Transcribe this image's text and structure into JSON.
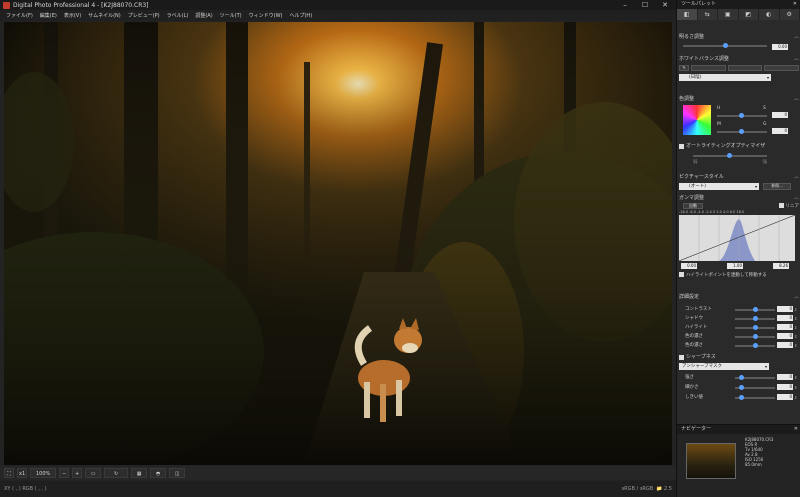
{
  "window": {
    "title": "Digital Photo Professional 4 - [K2J88070.CR3]",
    "minimize": "–",
    "maximize": "☐",
    "close": "✕"
  },
  "menu": [
    "ファイル(F)",
    "編集(E)",
    "表示(V)",
    "サムネイル(N)",
    "プレビュー(P)",
    "ラベル(L)",
    "調整(A)",
    "ツール(T)",
    "ウィンドウ(W)",
    "ヘルプ(H)"
  ],
  "toolbar": {
    "fit": "⛶",
    "x1": "x1",
    "zoom": "100%",
    "minus": "−",
    "plus": "+"
  },
  "status": {
    "left": "XY (    ,    )   RGB (    ,    ,    )",
    "right_a": "sRGB / sRGB",
    "right_b": "📁 2.5"
  },
  "palette": {
    "title": "ツールパレット",
    "close": "✕",
    "tabs": [
      "◧",
      "⇆",
      "▣",
      "◩",
      "◐",
      "⚙"
    ],
    "brightness": {
      "label": "明るさ調整",
      "value": "0.00"
    },
    "wb": {
      "label": "ホワイトバランス調整",
      "select": "(日陰)"
    },
    "color": {
      "label": "色調整",
      "h": "H",
      "s": "S",
      "m": "M",
      "g": "G",
      "v1": "0",
      "v2": "0"
    },
    "auto_light": {
      "label": "オートライティングオプティマイザ",
      "sub_a": "弱",
      "sub_b": "強"
    },
    "picture_style": {
      "label": "ピクチャースタイル",
      "select": "(オート)",
      "button": "参照..."
    },
    "tone": {
      "label": "ガンマ調整",
      "auto": "自動",
      "linear": "リニア",
      "scale": "-18.0  -6.0  -4.0  -2.0   0   2.0   4.0  6.0  18.0",
      "v_lo": "0.00",
      "v_mid": "1.00",
      "v_hi": "8.26",
      "link": "ハイライトポイントを連動して移動する"
    },
    "detail": {
      "label": "詳細設定",
      "rows": [
        {
          "label": "コントラスト",
          "value": "0"
        },
        {
          "label": "シャドウ",
          "value": "0"
        },
        {
          "label": "ハイライト",
          "value": "0"
        },
        {
          "label": "色の濃さ",
          "value": "0"
        },
        {
          "label": "色の濃さ",
          "value": "0"
        }
      ]
    },
    "sharp": {
      "label": "シャープネス",
      "select": "アンシャープマスク",
      "rows": [
        {
          "label": "強さ",
          "value": "0"
        },
        {
          "label": "細かさ",
          "value": "0"
        },
        {
          "label": "しきい値",
          "value": "0"
        }
      ]
    },
    "navigator": {
      "label": "ナビゲーター",
      "info": [
        "K2J88070.CR3",
        "EOS R",
        "Tv 1/640",
        "Av 2.8",
        "ISO 1250",
        "85.0mm"
      ]
    }
  }
}
